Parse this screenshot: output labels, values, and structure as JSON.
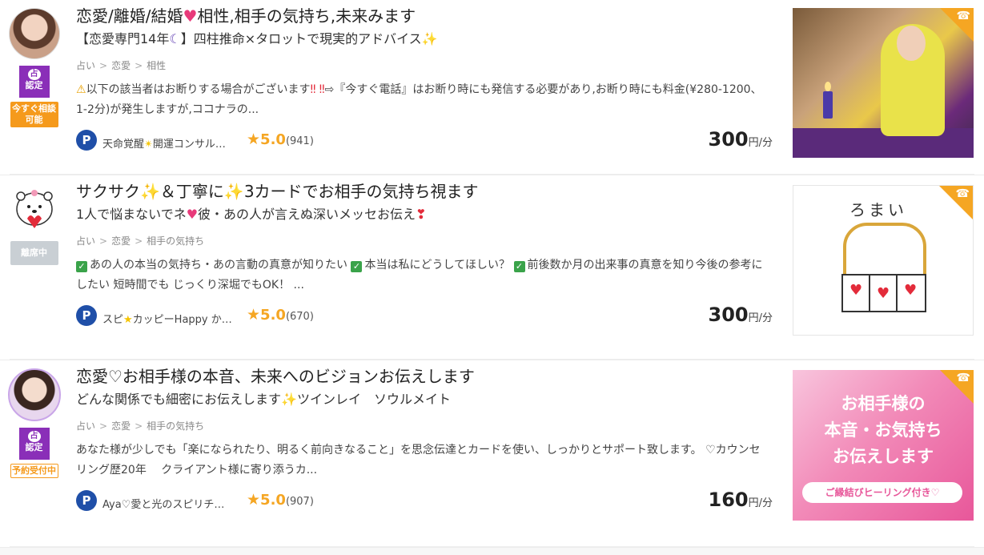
{
  "listings": [
    {
      "title_a": "恋愛/離婚/結婚",
      "title_b": "相性,相手の気持ち,未来みます",
      "subtitle_a": "【恋愛専門14年",
      "subtitle_b": "】四柱推命×タロットで現実的アドバイス",
      "crumbs": [
        "占い",
        "恋愛",
        "相性"
      ],
      "desc_a": "以下の該当者はお断りする場合がございます",
      "desc_b": "⇨『今すぐ電話』はお断り時にも発信する必要があり,お断り時にも料金(¥280-1200、1-2分)が発生しますが,ココナラの...",
      "cert_label": "認定",
      "status": "今すぐ相談可能",
      "provider": "天命覚醒",
      "provider_b": "開運コンサル…",
      "score": "5.0",
      "count": "(941)",
      "price": "300",
      "price_unit": "円/分"
    },
    {
      "title_a": "サクサク",
      "title_b": "＆丁寧に",
      "title_c": "3カードでお相手の気持ち視ます",
      "subtitle_a": "1人で悩まないでネ",
      "subtitle_b": "彼・あの人が言えぬ深いメッセお伝え",
      "crumbs": [
        "占い",
        "恋愛",
        "相手の気持ち"
      ],
      "desc_a": "あの人の本当の気持ち・あの言動の真意が知りたい",
      "desc_b": "本当は私にどうしてほしい？",
      "desc_c": "前後数か月の出来事の真意を知り今後の参考にしたい 短時間でも じっくり深堀でもOK！ ...",
      "status": "離席中",
      "provider": "スピ",
      "provider_b": "カッピーHappy か…",
      "score": "5.0",
      "count": "(670)",
      "price": "300",
      "price_unit": "円/分",
      "thumb_text": "ろまい"
    },
    {
      "title": "恋愛♡お相手様の本音、未来へのビジョンお伝えします",
      "subtitle_a": "どんな関係でも細密にお伝えします",
      "subtitle_b": "ツインレイ　ソウルメイト",
      "crumbs": [
        "占い",
        "恋愛",
        "相手の気持ち"
      ],
      "desc": "あなた様が少しでも「楽になられたり、明るく前向きなること」を思念伝達とカードを使い、しっかりとサポート致します。 ♡カウンセリング歴20年　 クライアント様に寄り添うカ...",
      "cert_label": "認定",
      "status": "予約受付中",
      "provider": "Aya♡愛と光のスピリチ…",
      "score": "5.0",
      "count": "(907)",
      "price": "160",
      "price_unit": "円/分",
      "banner_lines": [
        "お相手様の",
        "本音・お気持ち",
        "お伝えします"
      ],
      "banner_foot": "ご縁結びヒーリング付き♡"
    }
  ],
  "icons": {
    "cert": "fortune-cert-icon",
    "phone": "phone-icon",
    "star": "star-icon",
    "p_badge": "p-badge-icon"
  },
  "colors": {
    "accent_orange": "#f5a623",
    "cert_purple": "#8a2fb8",
    "p_blue": "#1f4fa8"
  }
}
